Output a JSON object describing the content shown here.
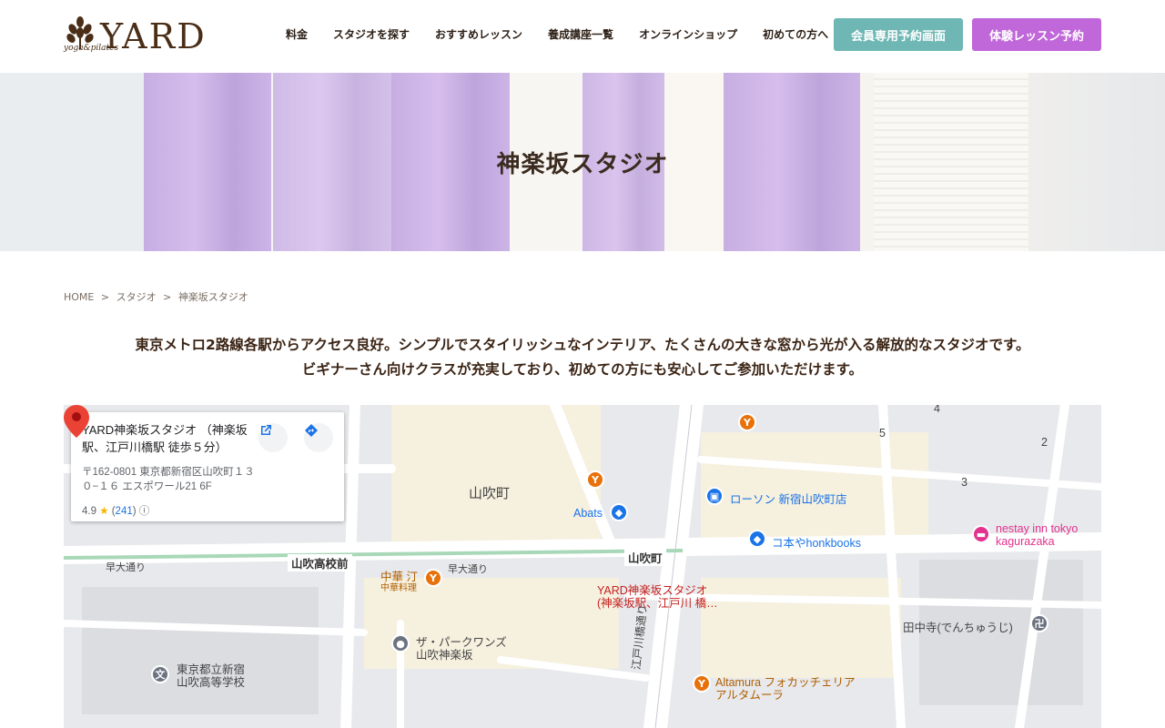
{
  "brand": {
    "name": "YARD",
    "tagline": "yoga&pilates"
  },
  "nav": {
    "items": [
      "料金",
      "スタジオを探す",
      "おすすめレッスン",
      "養成講座一覧",
      "オンラインショップ",
      "初めての方へ"
    ],
    "member_button": "会員専用予約画面",
    "trial_button": "体験レッスン予約"
  },
  "hero": {
    "title": "神楽坂スタジオ"
  },
  "breadcrumb": {
    "home": "HOME",
    "sep": ">",
    "studio": "スタジオ",
    "current": "神楽坂スタジオ"
  },
  "intro": {
    "line1": "東京メトロ2路線各駅からアクセス良好。シンプルでスタイリッシュなインテリア、たくさんの大きな窓から光が入る解放的なスタジオです。",
    "line2": "ビギナーさん向けクラスが充実しており、初めての方にも安心してご参加いただけます。"
  },
  "map": {
    "card": {
      "title": "YARD神楽坂スタジオ （神楽坂駅、江戸川橋駅 徒歩５分）",
      "address": "〒162-0801 東京都新宿区山吹町１３０−１６ エスポワール21 6F",
      "rating": "4.9",
      "reviews": "241"
    },
    "labels": {
      "yamabuki": "山吹町",
      "abats": "Abats",
      "lawson": "ローソン 新宿山吹町店",
      "honk": "コ本やhonkbooks",
      "nestay1": "nestay inn tokyo",
      "nestay2": "kagurazaka",
      "wasedadori1": "早大通り",
      "wasedadori2": "早大通り",
      "highschool_front": "山吹高校前",
      "yamabuki_sign": "山吹町",
      "chuka1": "中華 汀",
      "chuka2": "中華料理",
      "yard1": "YARD神楽坂スタジオ",
      "yard2": "(神楽坂駅、江戸川 橋…",
      "park1": "ザ・パークワンズ",
      "park2": "山吹神楽坂",
      "school1": "東京都立新宿",
      "school2": "山吹高等学校",
      "tanaka": "田中寺(でんちゅうじ)",
      "altamura1": "Altamura フォカッチェリア",
      "altamura2": "アルタムーラ",
      "edogawa": "江戸川橋通り",
      "n5": "5",
      "n4": "4",
      "n2": "2",
      "n3": "3"
    }
  }
}
